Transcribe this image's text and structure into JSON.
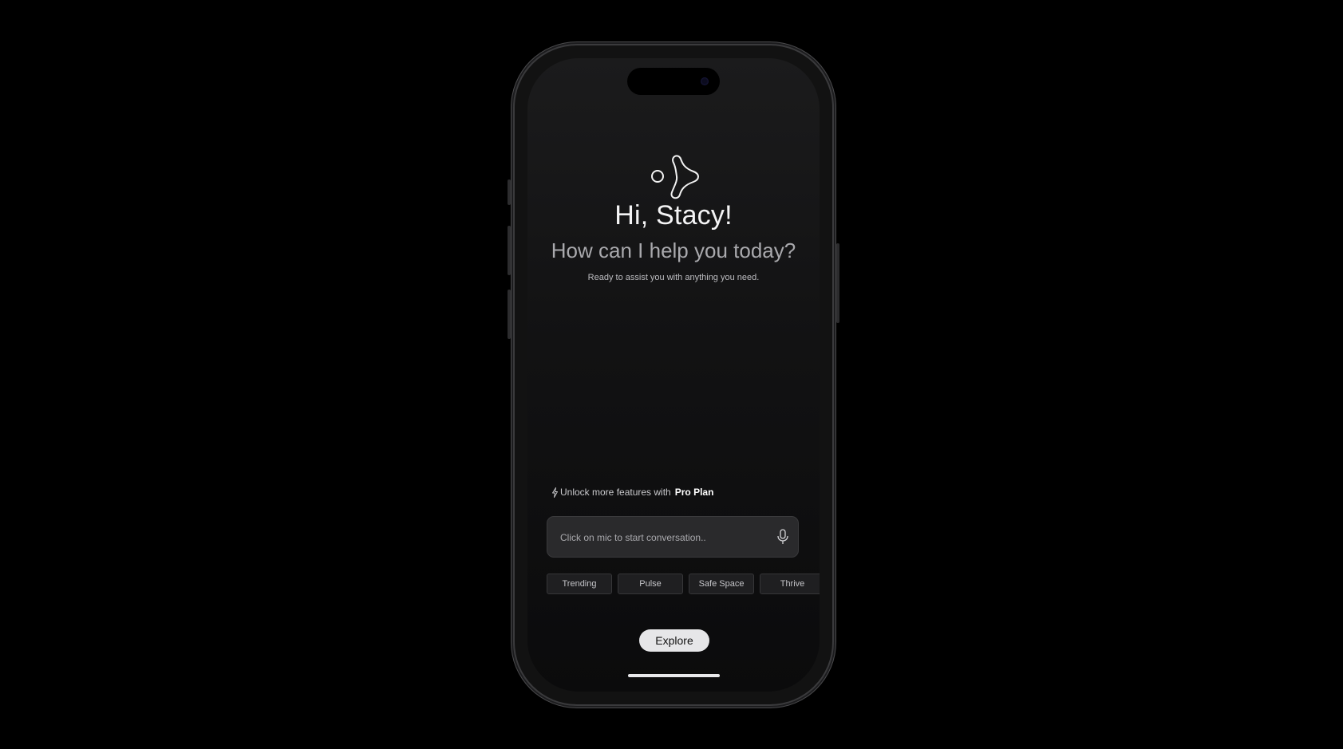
{
  "hero": {
    "greeting": "Hi, Stacy!",
    "subtitle": "How can I help you today?",
    "tagline": "Ready to assist you with anything you need."
  },
  "promo": {
    "text": "Unlock more features with",
    "plan": "Pro Plan",
    "icon": "lightning-bolt-icon"
  },
  "composer": {
    "placeholder": "Click on mic to start conversation..",
    "mic_icon": "microphone-icon"
  },
  "chips": [
    {
      "label": "Trending"
    },
    {
      "label": "Pulse"
    },
    {
      "label": "Safe Space"
    },
    {
      "label": "Thrive"
    }
  ],
  "actions": {
    "explore_label": "Explore"
  },
  "logo_icon": "molecule-logo-icon",
  "colors": {
    "background": "#000000",
    "screen": "#121213",
    "input": "#2a2a2c",
    "explore_button": "#e6e6e8",
    "text_primary": "#f4f4f5",
    "text_secondary": "#a9a9ad"
  }
}
